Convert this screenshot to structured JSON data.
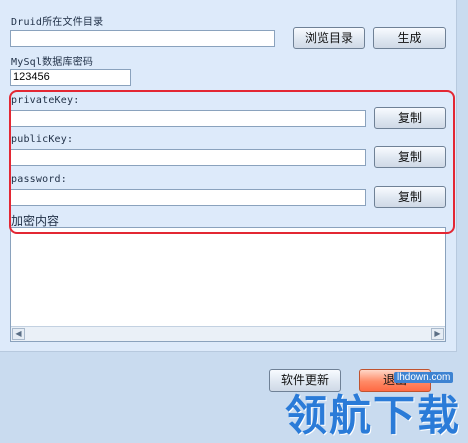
{
  "druid": {
    "label": "Druid所在文件目录",
    "path_value": "",
    "browse_btn": "浏览目录",
    "generate_btn": "生成"
  },
  "mysql": {
    "label": "MySql数据库密码",
    "password_value": "123456"
  },
  "keys": {
    "private_label": "privateKey:",
    "private_value": "",
    "public_label": "publicKey:",
    "public_value": "",
    "password_label": "password:",
    "password_value": "",
    "copy_btn": "复制"
  },
  "encrypted": {
    "label": "加密内容",
    "value": ""
  },
  "footer": {
    "update_btn": "软件更新",
    "exit_btn": "退出"
  },
  "watermark": {
    "url": "lhdown.com",
    "text": "领航下载"
  },
  "colors": {
    "highlight_border": "#e32733",
    "watermark": "#2a7bd8"
  }
}
